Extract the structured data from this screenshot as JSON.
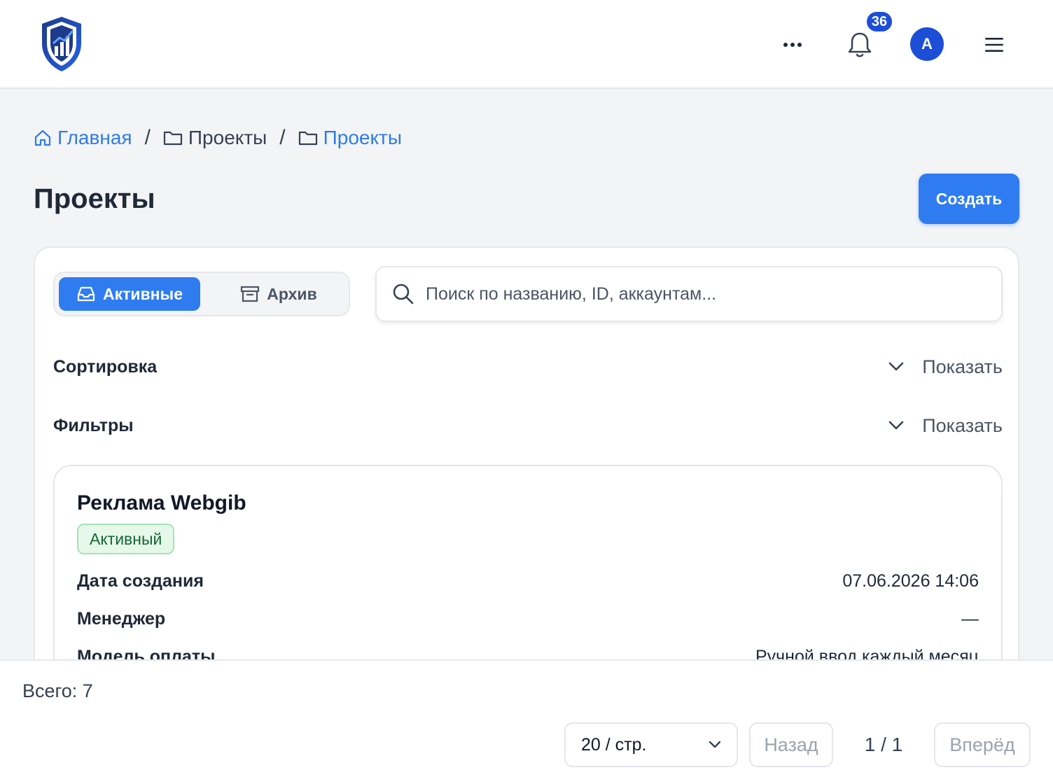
{
  "header": {
    "notifications_count": "36",
    "avatar_initial": "A"
  },
  "breadcrumb": {
    "home": "Главная",
    "parent": "Проекты",
    "current": "Проекты"
  },
  "page": {
    "title": "Проекты",
    "create_label": "Создать"
  },
  "tabs": {
    "active_label": "Активные",
    "archive_label": "Архив"
  },
  "search": {
    "placeholder": "Поиск по названию, ID, аккаунтам..."
  },
  "sorting": {
    "label": "Сортировка",
    "toggle": "Показать"
  },
  "filters": {
    "label": "Фильтры",
    "toggle": "Показать"
  },
  "project": {
    "title": "Реклама Webgib",
    "status": "Активный",
    "fields": [
      {
        "label": "Дата создания",
        "value": "07.06.2026 14:06"
      },
      {
        "label": "Менеджер",
        "value": "—"
      },
      {
        "label": "Модель оплаты",
        "value": "Ручной ввод каждый месяц"
      }
    ]
  },
  "footer": {
    "total": "Всего: 7",
    "per_page": "20 / стр.",
    "prev_label": "Назад",
    "page_info": "1 / 1",
    "next_label": "Вперёд"
  },
  "colors": {
    "primary": "#2f7cf0",
    "badge": "#1d4ed8",
    "status_bg": "#e6f8ea",
    "status_text": "#166534"
  }
}
